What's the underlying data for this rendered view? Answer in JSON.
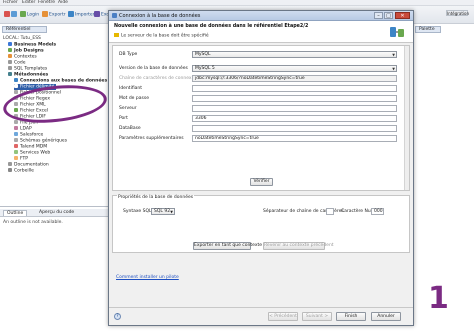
{
  "main_menu": [
    "Fichier",
    "Editer",
    "Fenêtre",
    "Aide"
  ],
  "perspective_label": "Intégration",
  "toolbar": {
    "items": [
      "Login",
      "Exportr",
      "Importer",
      "Exchange"
    ]
  },
  "repository": {
    "tab_label": "Référentiel",
    "path": "LOCAL: Tutu_ESS",
    "items": [
      {
        "label": "Business Models",
        "bold": true
      },
      {
        "label": "Job Designs",
        "bold": true
      },
      {
        "label": "Contextes",
        "bold": false
      },
      {
        "label": "Code",
        "bold": false
      },
      {
        "label": "SQL Templates",
        "bold": false
      },
      {
        "label": "Métadonnées",
        "bold": true
      },
      {
        "label": "Connexions aux bases de données",
        "bold": true
      },
      {
        "label": "Fichier délimité",
        "bold": false
      },
      {
        "label": "Fichier positionnel",
        "bold": false
      },
      {
        "label": "Fichier Regex",
        "bold": false
      },
      {
        "label": "Fichier XML",
        "bold": false
      },
      {
        "label": "Fichier Excel",
        "bold": false
      },
      {
        "label": "Fichier LDIF",
        "bold": false
      },
      {
        "label": "File Json",
        "bold": false
      },
      {
        "label": "LDAP",
        "bold": false
      },
      {
        "label": "Salesforce",
        "bold": false
      },
      {
        "label": "Schémas génériques",
        "bold": false
      },
      {
        "label": "Talend MDM",
        "bold": false
      },
      {
        "label": "Services Web",
        "bold": false
      },
      {
        "label": "FTP",
        "bold": false
      },
      {
        "label": "Documentation",
        "bold": false
      },
      {
        "label": "Corbeille",
        "bold": false
      }
    ]
  },
  "outline": {
    "tabs": [
      "Outline",
      "Aperçu du code"
    ],
    "message": "An outline is not available."
  },
  "right_panel": {
    "tab_label": "Palette"
  },
  "dialog": {
    "title": "Connexion à la base de données",
    "step_title": "Nouvelle connexion à une base de données dans le référentiel   Etape2/2",
    "info": "Le serveur de la base doit être spécifié",
    "form": {
      "db_type_label": "DB Type",
      "db_type_value": "MySQL",
      "db_version_label": "Version de la base de données",
      "db_version_value": "MySQL 5",
      "conn_string_label": "Chaîne de caractères de connexion",
      "conn_string_value": "jdbc:mysql://:3306/?noDatetimeStringSync=true",
      "login_label": "Identifiant",
      "login_value": "",
      "password_label": "Mot de passe",
      "password_value": "",
      "server_label": "Serveur",
      "server_value": "",
      "port_label": "Port",
      "port_value": "3306",
      "database_label": "DataBase",
      "database_value": "",
      "params_label": "Paramètres supplémentaires",
      "params_value": "noDatetimeStringSync=true",
      "check_button": "Vérifier"
    },
    "props": {
      "legend": "Propriétés de la base de données",
      "sql_syntax_label": "Syntaxe SQL",
      "sql_syntax_value": "SQL 92",
      "string_quote_label": "Séparateur de chaîne de caractères",
      "null_char_label": "Caractère Null",
      "null_char_value": "000",
      "export_button": "Exporter en tant que contexte",
      "revert_button": "Revenir au contexte précédent"
    },
    "link": "Comment installer un pilote",
    "footer": {
      "back": "< Précédent",
      "next": "Suivant >",
      "finish": "Finish",
      "cancel": "Annuler"
    }
  },
  "annotation_number": "1",
  "colors": {
    "highlight": "#7b2b83",
    "selection": "#2f5ea8",
    "link": "#1d4fc2"
  }
}
